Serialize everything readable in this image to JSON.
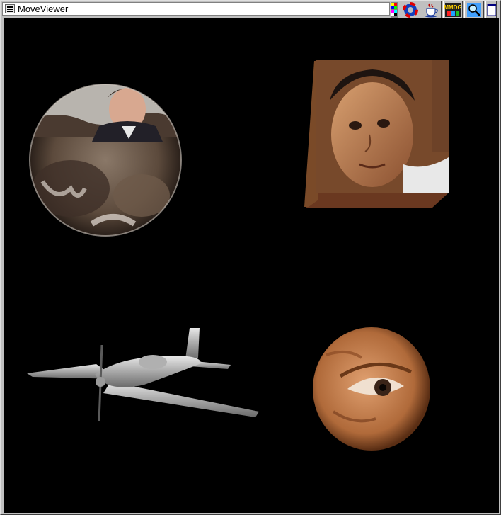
{
  "window": {
    "title": "MoveViewer"
  },
  "toolbar": {
    "buttons": [
      {
        "name": "lifebuoy-icon"
      },
      {
        "name": "java-cup-icon"
      },
      {
        "name": "mmdg-icon",
        "label": "MMDG"
      },
      {
        "name": "magnifier-icon"
      },
      {
        "name": "window-overflow-icon"
      }
    ]
  },
  "scene": {
    "background": "#000000",
    "objects": [
      {
        "name": "textured-sphere-man",
        "kind": "sphere"
      },
      {
        "name": "textured-cube-child-face",
        "kind": "cube"
      },
      {
        "name": "airplane-model",
        "kind": "model"
      },
      {
        "name": "textured-sphere-eye",
        "kind": "sphere"
      }
    ]
  }
}
